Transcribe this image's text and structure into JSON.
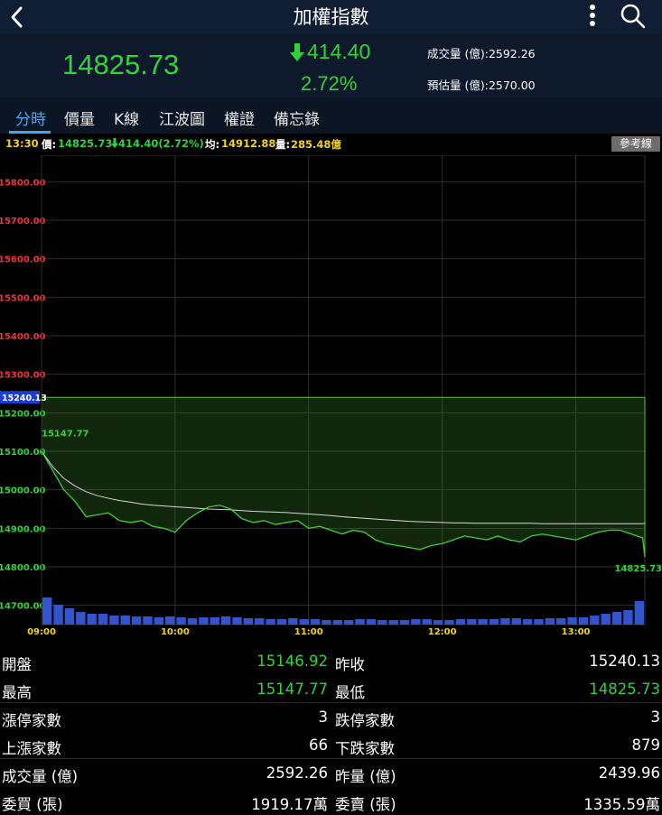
{
  "header": {
    "title": "加權指數",
    "back_icon": "chevron-left-icon",
    "more_icon": "vertical-dots-icon",
    "search_icon": "search-icon"
  },
  "quote": {
    "price": "14825.73",
    "change": "414.40",
    "change_pct": "2.72%",
    "volume_label": "成交量 (億):2592.26",
    "estimated_label": "預估量 (億):2570.00",
    "color_down": "#2fd33a"
  },
  "tabs": [
    "分時",
    "價量",
    "K線",
    "江波圖",
    "權證",
    "備忘錄"
  ],
  "infobar": {
    "time": "13:30",
    "price_label": "價:",
    "price": "14825.73",
    "change": "414.40(2.72%)",
    "avg_label": "均:",
    "avg": "14912.88",
    "vol_label": "量:",
    "vol": "285.48億",
    "ref_button": "參考線"
  },
  "chart_data": {
    "type": "line",
    "ylim": [
      14650,
      15850
    ],
    "yticks": [
      "15800.00",
      "15700.00",
      "15600.00",
      "15500.00",
      "15400.00",
      "15300.00",
      "15200.00",
      "15100.00",
      "15000.00",
      "14900.00",
      "14800.00",
      "14700.00"
    ],
    "xticks": [
      "09:00",
      "10:00",
      "11:00",
      "12:00",
      "13:00"
    ],
    "reference": "15240.13",
    "high_label": "15147.77",
    "last_label": "14825.73",
    "x_minutes": [
      0,
      5,
      10,
      15,
      20,
      25,
      30,
      35,
      40,
      45,
      50,
      55,
      60,
      65,
      70,
      75,
      80,
      85,
      90,
      95,
      100,
      105,
      110,
      115,
      120,
      125,
      130,
      135,
      140,
      145,
      150,
      155,
      160,
      165,
      170,
      175,
      180,
      185,
      190,
      195,
      200,
      205,
      210,
      215,
      220,
      225,
      230,
      235,
      240,
      245,
      250,
      255,
      260,
      265,
      270,
      271
    ],
    "price": [
      15100,
      15050,
      15000,
      14970,
      14930,
      14935,
      14940,
      14920,
      14915,
      14920,
      14905,
      14900,
      14890,
      14920,
      14940,
      14955,
      14960,
      14950,
      14925,
      14915,
      14920,
      14910,
      14915,
      14920,
      14900,
      14905,
      14895,
      14885,
      14895,
      14890,
      14870,
      14860,
      14855,
      14850,
      14845,
      14855,
      14860,
      14870,
      14880,
      14875,
      14870,
      14880,
      14870,
      14865,
      14880,
      14885,
      14880,
      14875,
      14870,
      14880,
      14890,
      14895,
      14895,
      14885,
      14875,
      14825.73
    ],
    "avg": [
      15100,
      15060,
      15030,
      15010,
      14995,
      14985,
      14978,
      14972,
      14968,
      14963,
      14960,
      14958,
      14956,
      14954,
      14952,
      14950,
      14949,
      14948,
      14946,
      14944,
      14943,
      14942,
      14941,
      14939,
      14937,
      14935,
      14933,
      14930,
      14928,
      14926,
      14924,
      14922,
      14920,
      14918,
      14917,
      14916,
      14915,
      14914,
      14914,
      14913,
      14913,
      14913,
      14913,
      14913,
      14913,
      14912,
      14912,
      14912,
      14912,
      14912,
      14912,
      14912,
      14912,
      14912,
      14912,
      14912.88
    ],
    "volume_bars": [
      30,
      22,
      18,
      14,
      12,
      12,
      10,
      10,
      9,
      9,
      8,
      9,
      8,
      7,
      8,
      8,
      9,
      8,
      7,
      7,
      6,
      6,
      7,
      6,
      6,
      5,
      5,
      5,
      6,
      6,
      5,
      5,
      5,
      6,
      6,
      5,
      5,
      6,
      6,
      6,
      6,
      7,
      7,
      6,
      6,
      7,
      7,
      8,
      8,
      10,
      12,
      14,
      16,
      26
    ]
  },
  "stats": [
    {
      "l1": "開盤",
      "v1": "15146.92",
      "c1": "green",
      "l2": "昨收",
      "v2": "15240.13",
      "c2": "white"
    },
    {
      "l1": "最高",
      "v1": "15147.77",
      "c1": "green",
      "l2": "最低",
      "v2": "14825.73",
      "c2": "green"
    },
    {
      "l1": "漲停家數",
      "v1": "3",
      "c1": "white",
      "l2": "跌停家數",
      "v2": "3",
      "c2": "white"
    },
    {
      "l1": "上漲家數",
      "v1": "66",
      "c1": "white",
      "l2": "下跌家數",
      "v2": "879",
      "c2": "white"
    },
    {
      "l1": "成交量 (億)",
      "v1": "2592.26",
      "c1": "white",
      "l2": "昨量 (億)",
      "v2": "2439.96",
      "c2": "white"
    },
    {
      "l1": "委買 (張)",
      "v1": "1919.17萬",
      "c1": "white",
      "l2": "委賣 (張)",
      "v2": "1335.59萬",
      "c2": "white"
    }
  ]
}
